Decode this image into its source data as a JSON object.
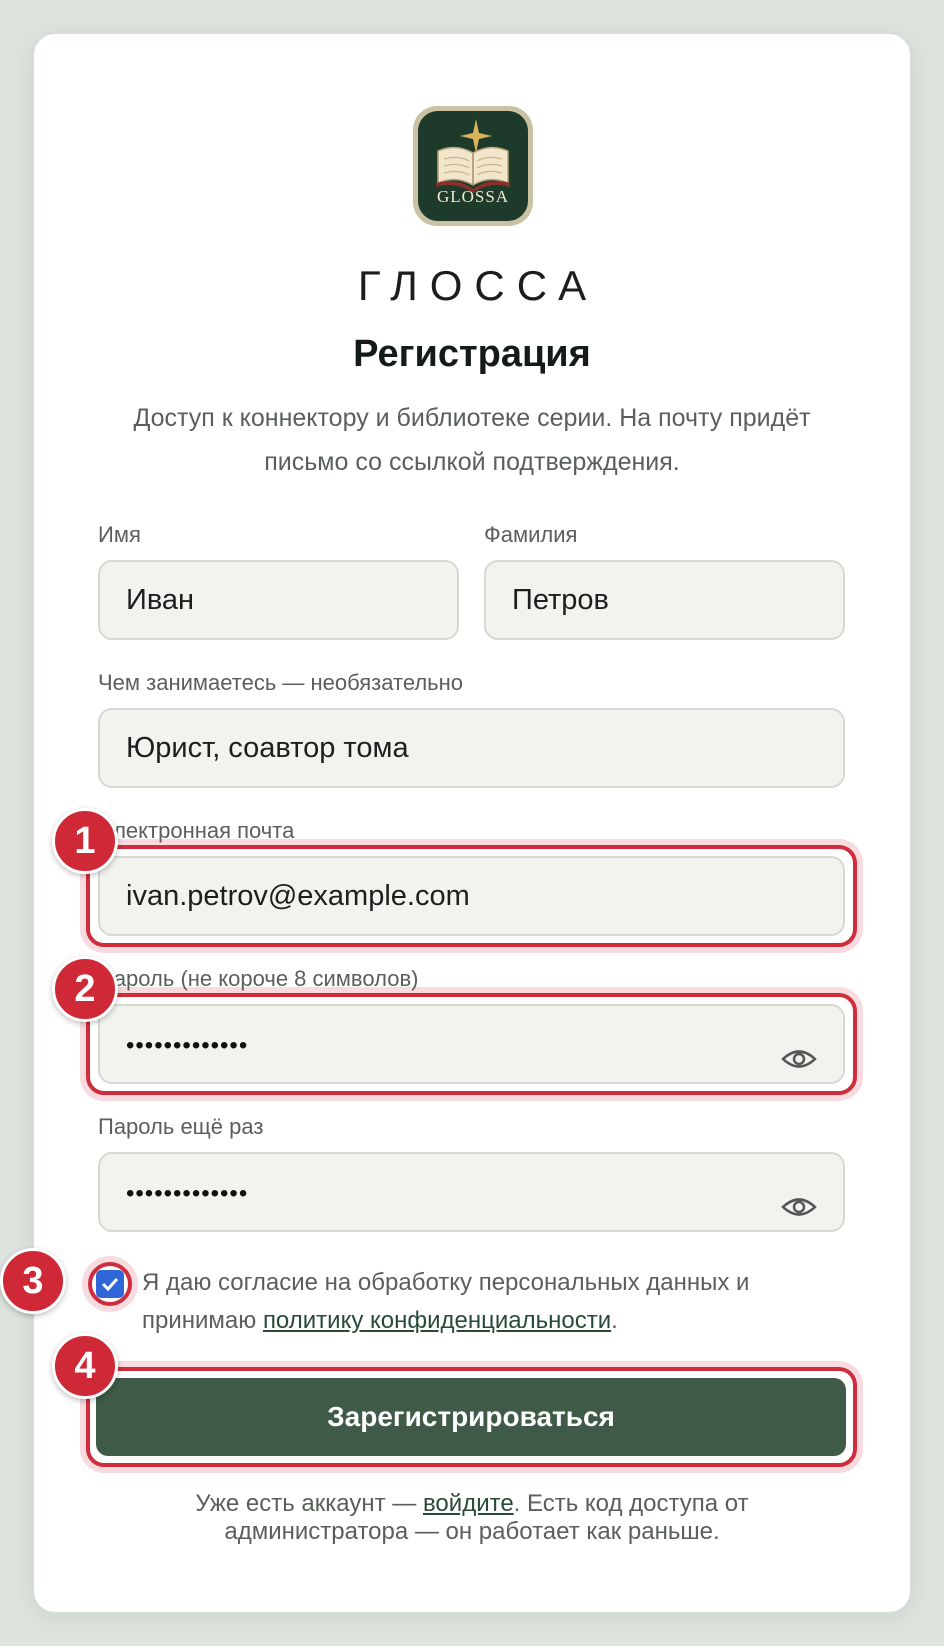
{
  "brand": {
    "logo_text": "GLOSSA",
    "name": "ГЛОССА"
  },
  "form": {
    "title": "Регистрация",
    "subtitle": "Доступ к коннектору и библиотеке серии. На почту придёт письмо со ссылкой подтверждения.",
    "first_name": {
      "label": "Имя",
      "value": "Иван"
    },
    "last_name": {
      "label": "Фамилия",
      "value": "Петров"
    },
    "occupation": {
      "label": "Чем занимаетесь — необязательно",
      "value": "Юрист, соавтор тома"
    },
    "email": {
      "label": "Электронная почта",
      "value": "ivan.petrov@example.com"
    },
    "password": {
      "label": "Пароль (не короче 8 символов)",
      "value": "•••••••••••••"
    },
    "password_repeat": {
      "label": "Пароль ещё раз",
      "value": "•••••••••••••"
    },
    "consent": {
      "checked": true,
      "text_before": "Я даю согласие на обработку персональных данных и принимаю ",
      "link": "политику конфиденциальности",
      "text_after": "."
    },
    "submit_label": "Зарегистрироваться",
    "footer": {
      "text_before": "Уже есть аккаунт — ",
      "link": "войдите",
      "text_after": ". Есть код доступа от администратора — он работает как раньше."
    }
  },
  "annotations": [
    "1",
    "2",
    "3",
    "4"
  ],
  "colors": {
    "accent": "#3f5a47",
    "highlight": "#cf2c3c",
    "checkbox": "#2f67d6"
  },
  "icons": [
    "book-logo-icon",
    "eye-icon",
    "checkmark-icon"
  ]
}
